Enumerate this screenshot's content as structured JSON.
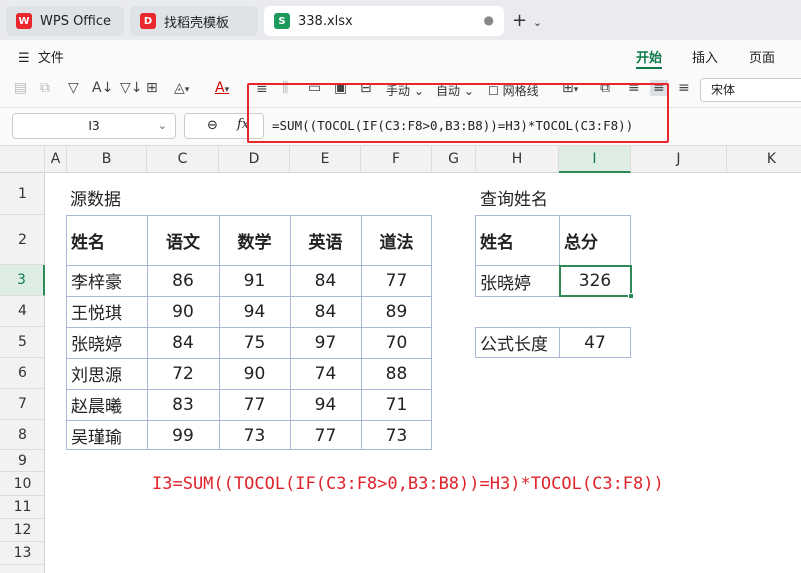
{
  "tabs": [
    {
      "label": "WPS Office",
      "icon": "wps-logo-icon",
      "color": "#e8262c"
    },
    {
      "label": "找稻壳模板",
      "icon": "docer-logo-icon",
      "color": "#e8262c"
    },
    {
      "label": "338.xlsx",
      "icon": "spreadsheet-icon",
      "color": "#1d9a5b"
    }
  ],
  "menu": {
    "file": "文件",
    "items": [
      "开始",
      "插入",
      "页面"
    ],
    "active": "开始"
  },
  "toolbar": {
    "manual": "手动",
    "auto": "自动",
    "gridlines": "网格线",
    "font": "宋体"
  },
  "formula_bar": {
    "cell_ref": "I3",
    "fx": "fx",
    "formula": "=SUM((TOCOL(IF(C3:F8>0,B3:B8))=H3)*TOCOL(C3:F8))"
  },
  "columns": [
    "A",
    "B",
    "C",
    "D",
    "E",
    "F",
    "G",
    "H",
    "I",
    "J",
    "K"
  ],
  "selected_column": "I",
  "rows": [
    "1",
    "2",
    "3",
    "4",
    "5",
    "6",
    "7",
    "8",
    "9",
    "10",
    "11",
    "12",
    "13"
  ],
  "selected_row": "3",
  "source": {
    "title": "源数据",
    "headers": [
      "姓名",
      "语文",
      "数学",
      "英语",
      "道法"
    ],
    "rows": [
      [
        "李梓豪",
        "86",
        "91",
        "84",
        "77"
      ],
      [
        "王悦琪",
        "90",
        "94",
        "84",
        "89"
      ],
      [
        "张晓婷",
        "84",
        "75",
        "97",
        "70"
      ],
      [
        "刘思源",
        "72",
        "90",
        "74",
        "88"
      ],
      [
        "赵晨曦",
        "83",
        "77",
        "94",
        "71"
      ],
      [
        "吴瑾瑜",
        "99",
        "73",
        "77",
        "73"
      ]
    ]
  },
  "query": {
    "title": "查询姓名",
    "headers": [
      "姓名",
      "总分"
    ],
    "name": "张晓婷",
    "total": "326",
    "length_label": "公式长度",
    "length_value": "47"
  },
  "annotation": "I3=SUM((TOCOL(IF(C3:F8>0,B3:B8))=H3)*TOCOL(C3:F8))"
}
